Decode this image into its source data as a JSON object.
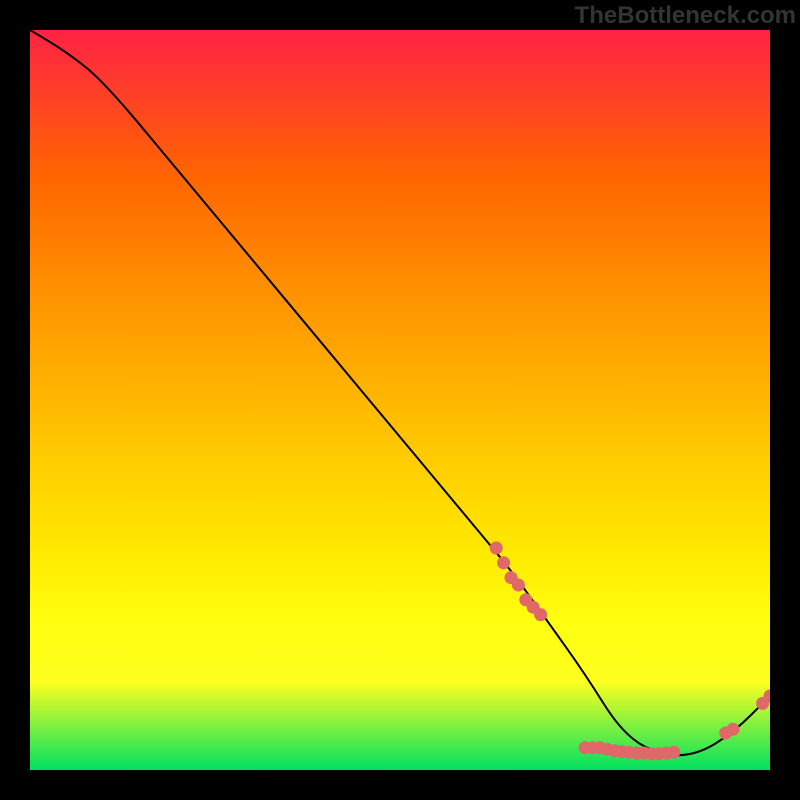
{
  "watermark": "TheBottleneck.com",
  "colors": {
    "curve": "#000000",
    "point": "#e06868",
    "bg_black": "#000000"
  },
  "chart_data": {
    "type": "line",
    "title": "",
    "xlabel": "",
    "ylabel": "",
    "xlim": [
      0,
      100
    ],
    "ylim": [
      0,
      100
    ],
    "curve": {
      "x": [
        0,
        5,
        10,
        20,
        30,
        40,
        50,
        60,
        65,
        70,
        75,
        80,
        85,
        90,
        95,
        100
      ],
      "y": [
        100,
        97,
        93,
        81,
        69,
        57,
        45,
        33,
        27,
        20,
        13,
        5,
        2,
        2,
        5,
        10
      ]
    },
    "points": [
      {
        "x": 63,
        "y": 30
      },
      {
        "x": 64,
        "y": 28
      },
      {
        "x": 65,
        "y": 26
      },
      {
        "x": 66,
        "y": 25
      },
      {
        "x": 67,
        "y": 23
      },
      {
        "x": 68,
        "y": 22
      },
      {
        "x": 69,
        "y": 21
      },
      {
        "x": 75,
        "y": 3
      },
      {
        "x": 76,
        "y": 3
      },
      {
        "x": 77,
        "y": 3
      },
      {
        "x": 78,
        "y": 2.8
      },
      {
        "x": 79,
        "y": 2.6
      },
      {
        "x": 80,
        "y": 2.5
      },
      {
        "x": 81,
        "y": 2.4
      },
      {
        "x": 82,
        "y": 2.3
      },
      {
        "x": 83,
        "y": 2.3
      },
      {
        "x": 84,
        "y": 2.2
      },
      {
        "x": 85,
        "y": 2.2
      },
      {
        "x": 86,
        "y": 2.3
      },
      {
        "x": 87,
        "y": 2.4
      },
      {
        "x": 94,
        "y": 5
      },
      {
        "x": 95,
        "y": 5.5
      },
      {
        "x": 99,
        "y": 9
      },
      {
        "x": 100,
        "y": 10
      }
    ]
  }
}
